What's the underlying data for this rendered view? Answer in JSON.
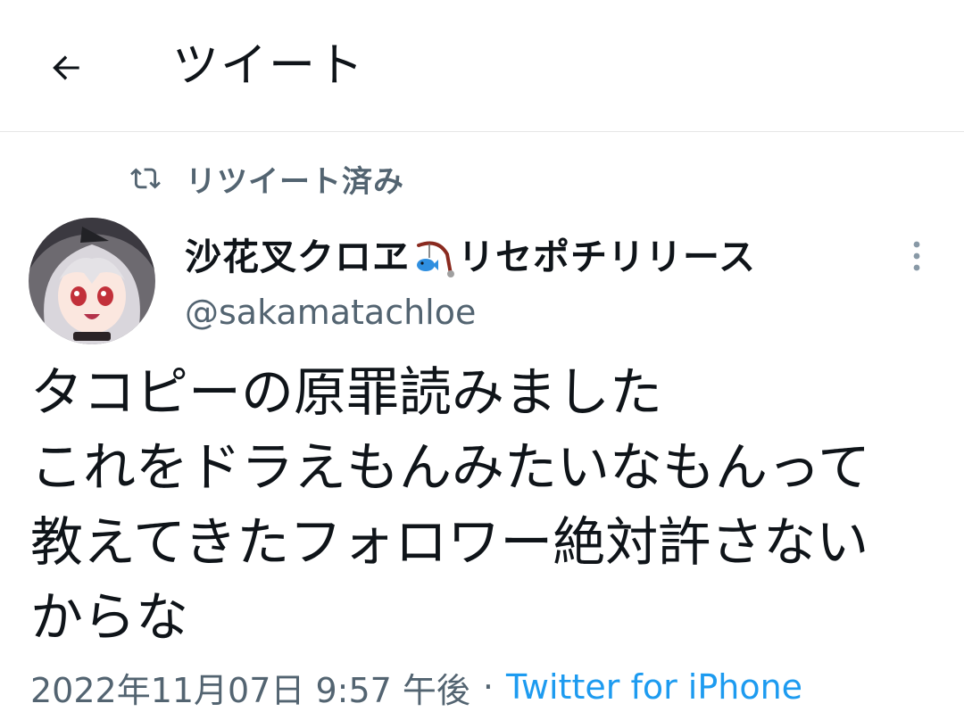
{
  "header": {
    "title": "ツイート",
    "back_icon": "arrow-left-icon"
  },
  "retweet": {
    "label": "リツイート済み",
    "icon": "retweet-icon"
  },
  "tweet": {
    "display_name_prefix": "沙花叉クロヱ",
    "display_name_emoji": "fishing-pole-icon",
    "display_name_suffix": "リセポチリリース",
    "handle": "@sakamatachloe",
    "text_lines": [
      "タコピーの原罪読みました",
      "これをドラえもんみたいなもんって",
      "教えてきたフォロワー絶対許さない",
      "からな"
    ],
    "date": "2022年11月07日 9:57 午後",
    "separator": "·",
    "source": "Twitter for iPhone"
  },
  "colors": {
    "text": "#0f1419",
    "muted": "#536471",
    "accent": "#1d9bf0",
    "divider": "#e6e6e6"
  }
}
